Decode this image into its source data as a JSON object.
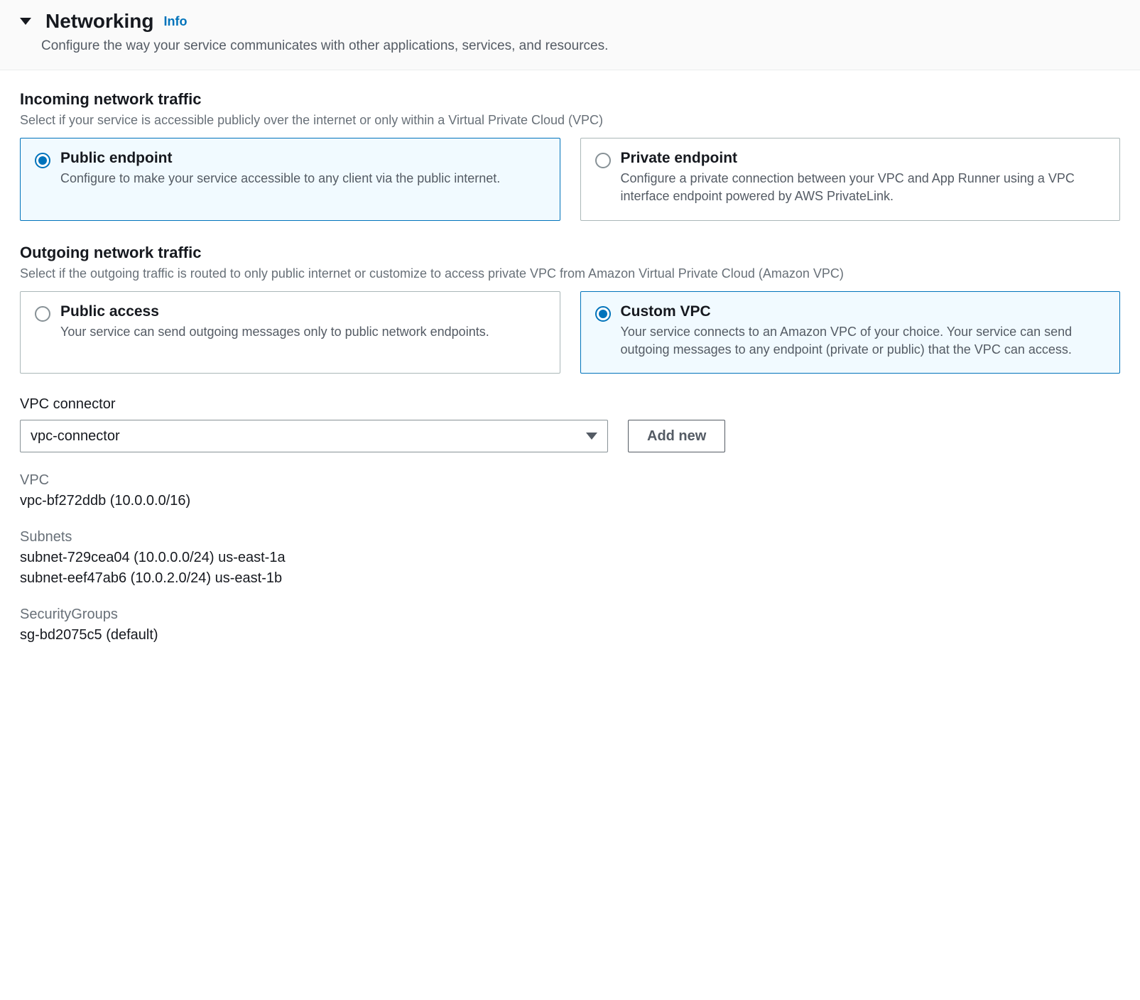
{
  "header": {
    "title": "Networking",
    "info": "Info",
    "subtitle": "Configure the way your service communicates with other applications, services, and resources."
  },
  "incoming": {
    "title": "Incoming network traffic",
    "desc": "Select if your service is accessible publicly over the internet or only within a Virtual Private Cloud (VPC)",
    "options": [
      {
        "title": "Public endpoint",
        "desc": "Configure to make your service accessible to any client via the public internet.",
        "selected": true
      },
      {
        "title": "Private endpoint",
        "desc": "Configure a private connection between your VPC and App Runner using a VPC interface endpoint powered by AWS PrivateLink.",
        "selected": false
      }
    ]
  },
  "outgoing": {
    "title": "Outgoing network traffic",
    "desc": "Select if the outgoing traffic is routed to only public internet or customize to access private VPC from Amazon Virtual Private Cloud (Amazon VPC)",
    "options": [
      {
        "title": "Public access",
        "desc": "Your service can send outgoing messages only to public network endpoints.",
        "selected": false
      },
      {
        "title": "Custom VPC",
        "desc": "Your service connects to an Amazon VPC of your choice. Your service can send outgoing messages to any endpoint (private or public) that the VPC can access.",
        "selected": true
      }
    ]
  },
  "vpc_connector": {
    "label": "VPC connector",
    "selected": "vpc-connector",
    "add_button": "Add new"
  },
  "details": {
    "vpc": {
      "label": "VPC",
      "value": "vpc-bf272ddb (10.0.0.0/16)"
    },
    "subnets": {
      "label": "Subnets",
      "values": [
        "subnet-729cea04 (10.0.0.0/24) us-east-1a",
        "subnet-eef47ab6 (10.0.2.0/24) us-east-1b"
      ]
    },
    "security_groups": {
      "label": "SecurityGroups",
      "value": "sg-bd2075c5 (default)"
    }
  }
}
